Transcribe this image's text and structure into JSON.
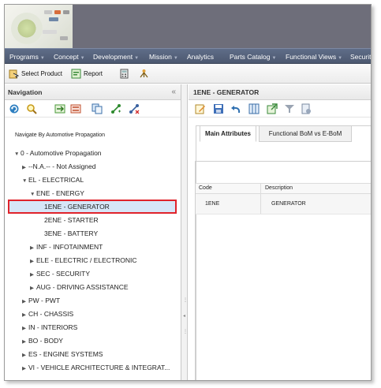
{
  "menu": {
    "items": [
      "Programs",
      "Concept",
      "Development",
      "Mission",
      "Analytics",
      "Parts Catalog",
      "Functional Views",
      "Securit"
    ]
  },
  "toolbar": {
    "select_product": "Select Product",
    "report": "Report"
  },
  "navigation": {
    "title": "Navigation",
    "collapse_glyph": "«",
    "caption": "Navigate By Automotive Propagation",
    "tree": [
      {
        "label": "0 - Automotive Propagation",
        "expanded": true
      },
      {
        "label": "--N.A.-- - Not Assigned",
        "expanded": false
      },
      {
        "label": "EL - ELECTRICAL",
        "expanded": true
      },
      {
        "label": "ENE - ENERGY",
        "expanded": true
      },
      {
        "label": "1ENE - GENERATOR",
        "selected": true
      },
      {
        "label": "2ENE - STARTER"
      },
      {
        "label": "3ENE - BATTERY"
      },
      {
        "label": "INF - INFOTAINMENT",
        "expanded": false
      },
      {
        "label": "ELE - ELECTRIC / ELECTRONIC",
        "expanded": false
      },
      {
        "label": "SEC - SECURITY",
        "expanded": false
      },
      {
        "label": "AUG - DRIVING ASSISTANCE",
        "expanded": false
      },
      {
        "label": "PW - PWT",
        "expanded": false
      },
      {
        "label": "CH - CHASSIS",
        "expanded": false
      },
      {
        "label": "IN - INTERIORS",
        "expanded": false
      },
      {
        "label": "BO - BODY",
        "expanded": false
      },
      {
        "label": "ES - ENGINE SYSTEMS",
        "expanded": false
      },
      {
        "label": "VI - VEHICLE ARCHITECTURE & INTEGRAT...",
        "expanded": false
      }
    ]
  },
  "detail": {
    "title": "1ENE - GENERATOR",
    "tabs": [
      "Main Attributes",
      "Functional BoM vs E-BoM"
    ],
    "columns": [
      "Code",
      "Description"
    ],
    "rows": [
      {
        "code": "1ENE",
        "description": "GENERATOR"
      }
    ]
  },
  "colors": {
    "menubar": "#4c5870",
    "selection_border": "#e0232b",
    "selection_fill": "#d6e6f7"
  }
}
